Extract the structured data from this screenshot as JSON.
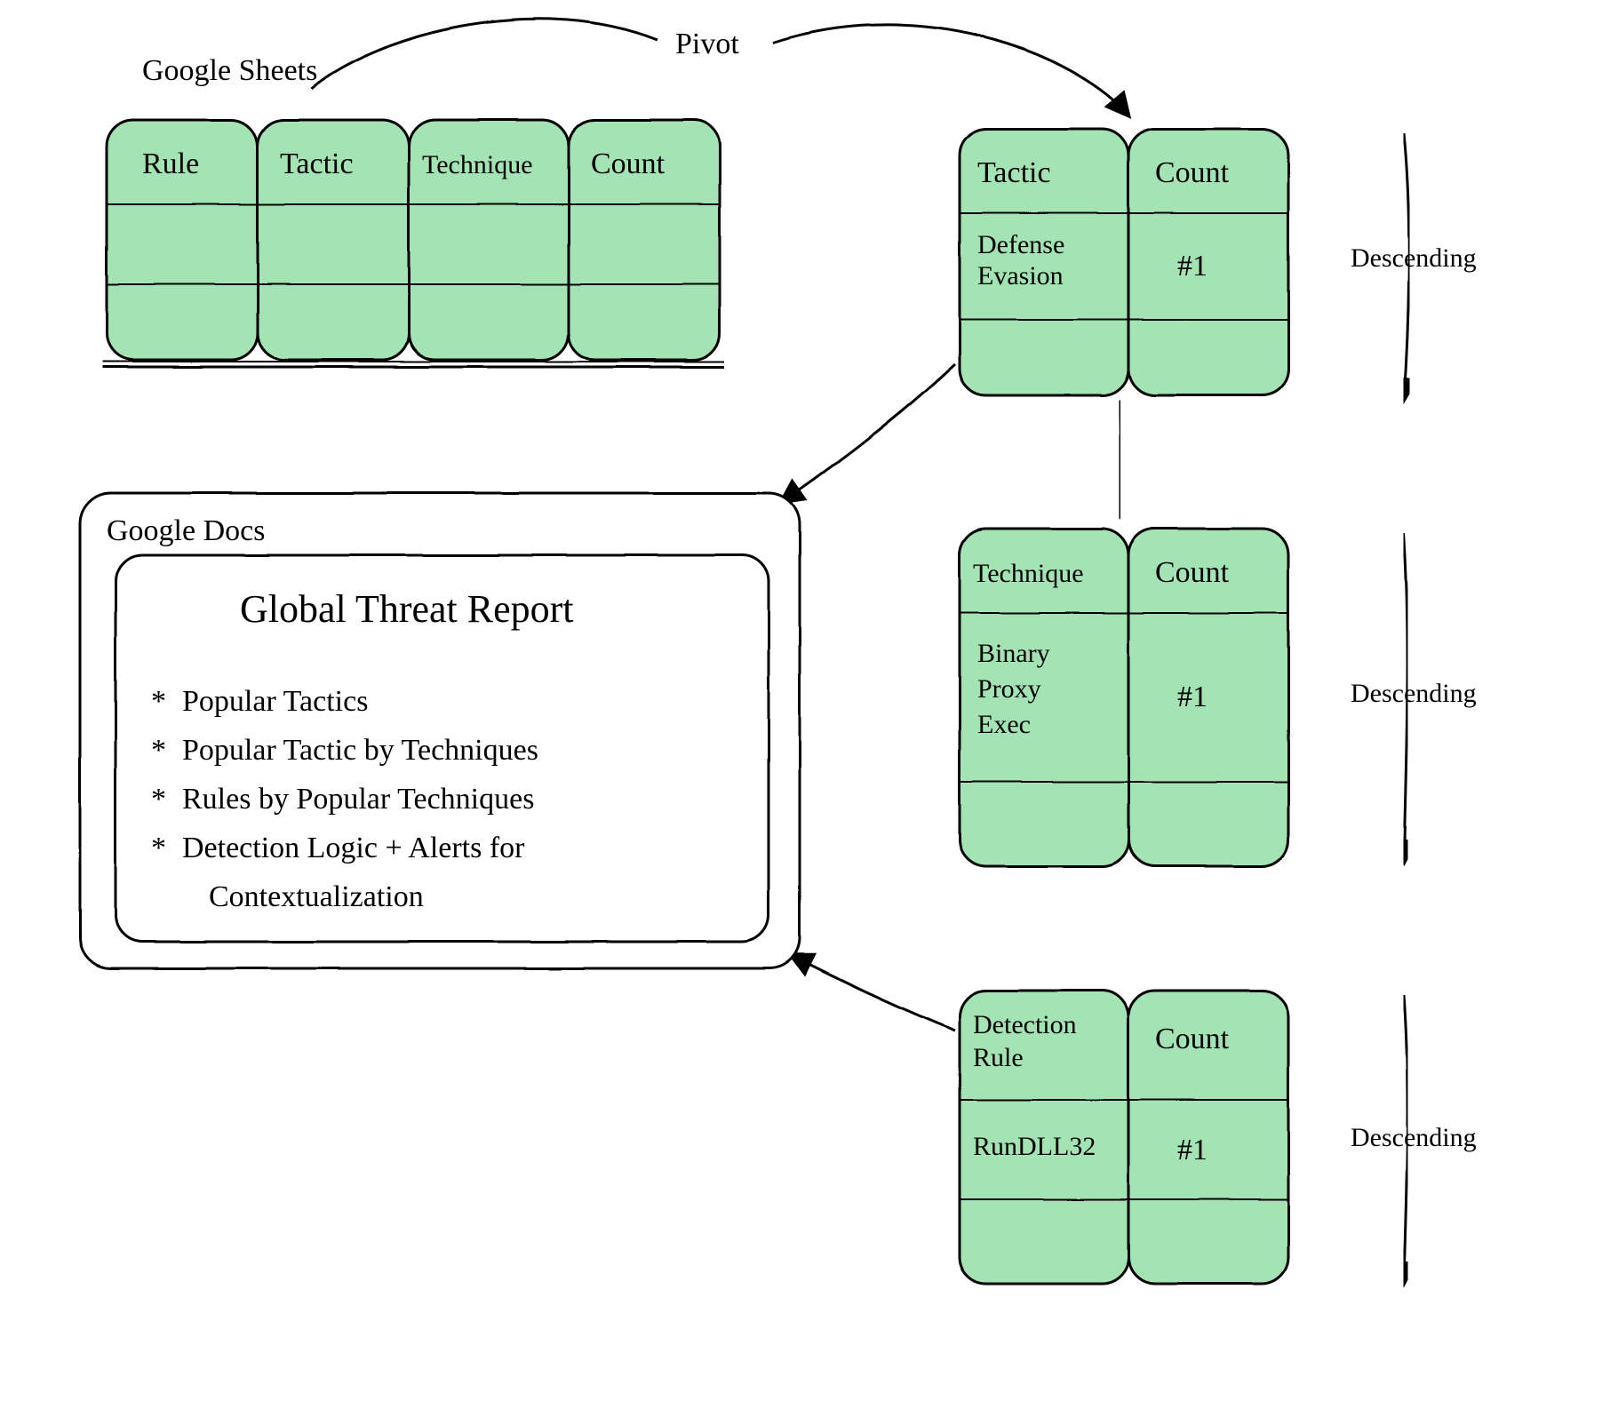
{
  "labels": {
    "sheets": "Google Sheets",
    "docs": "Google Docs",
    "pivot": "Pivot",
    "descending": "Descending",
    "reportTitle": "Global Threat Report"
  },
  "sheetsTable": {
    "headers": [
      "Rule",
      "Tactic",
      "Technique",
      "Count"
    ]
  },
  "tacticTable": {
    "headers": [
      "Tactic",
      "Count"
    ],
    "row": [
      "Defense Evasion",
      "#1"
    ]
  },
  "techniqueTable": {
    "headers": [
      "Technique",
      "Count"
    ],
    "row": [
      "Binary Proxy Exec",
      "#1"
    ]
  },
  "ruleTable": {
    "headers": [
      "Detection Rule",
      "Count"
    ],
    "row": [
      "RunDLL32",
      "#1"
    ]
  },
  "bullets": [
    "Popular Tactics",
    "Popular Tactic by Techniques",
    "Rules by Popular Techniques",
    "Detection Logic + Alerts for Contextualization"
  ]
}
